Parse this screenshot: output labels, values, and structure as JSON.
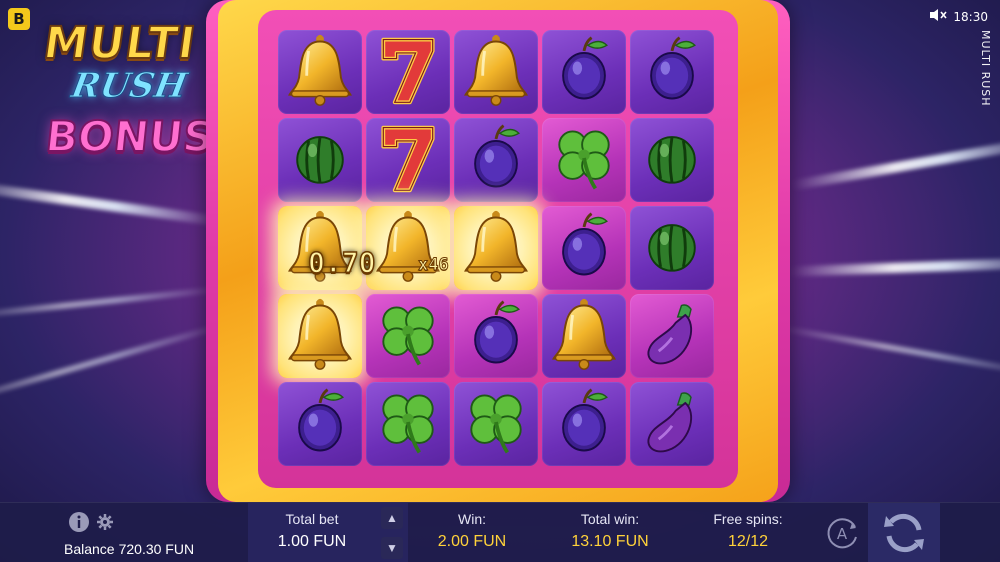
{
  "brand_badge": "B",
  "status": {
    "time": "18:30",
    "sound_icon": "speaker-muted-icon"
  },
  "game_name_vertical": "MULTI RUSH",
  "logo": {
    "line1": "MULTI",
    "line2": "RUSH",
    "line3": "BONUS"
  },
  "colors": {
    "accent_gold": "#ffd23a",
    "frame_pink": "#e03aa8",
    "tile_purple": "#6c2fb8",
    "bar_bg": "#1e1c4a"
  },
  "reels": [
    [
      "bell",
      "seven",
      "bell",
      "plum",
      "plum"
    ],
    [
      "watermelon",
      "seven",
      "plum",
      "clover",
      "watermelon"
    ],
    [
      "bell",
      "bell",
      "bell",
      "plum",
      "watermelon"
    ],
    [
      "bell",
      "clover",
      "plum",
      "bell",
      "eggplant"
    ],
    [
      "plum",
      "clover",
      "clover",
      "plum",
      "eggplant"
    ]
  ],
  "highlighted_cells": [
    [
      2,
      0
    ],
    [
      2,
      1
    ],
    [
      2,
      2
    ],
    [
      3,
      0
    ]
  ],
  "pink_cells": [
    [
      2,
      3
    ],
    [
      3,
      1
    ],
    [
      3,
      2
    ],
    [
      3,
      4
    ],
    [
      1,
      3
    ]
  ],
  "win_overlay": {
    "amount": "0.70",
    "multiplier": "x46"
  },
  "bottom_bar": {
    "balance_label": "Balance",
    "balance_value": "720.30 FUN",
    "total_bet_label": "Total bet",
    "total_bet_value": "1.00 FUN",
    "win_label": "Win:",
    "win_value": "2.00 FUN",
    "total_win_label": "Total win:",
    "total_win_value": "13.10 FUN",
    "free_spins_label": "Free spins:",
    "free_spins_value": "12/12",
    "autoplay_letter": "A"
  }
}
